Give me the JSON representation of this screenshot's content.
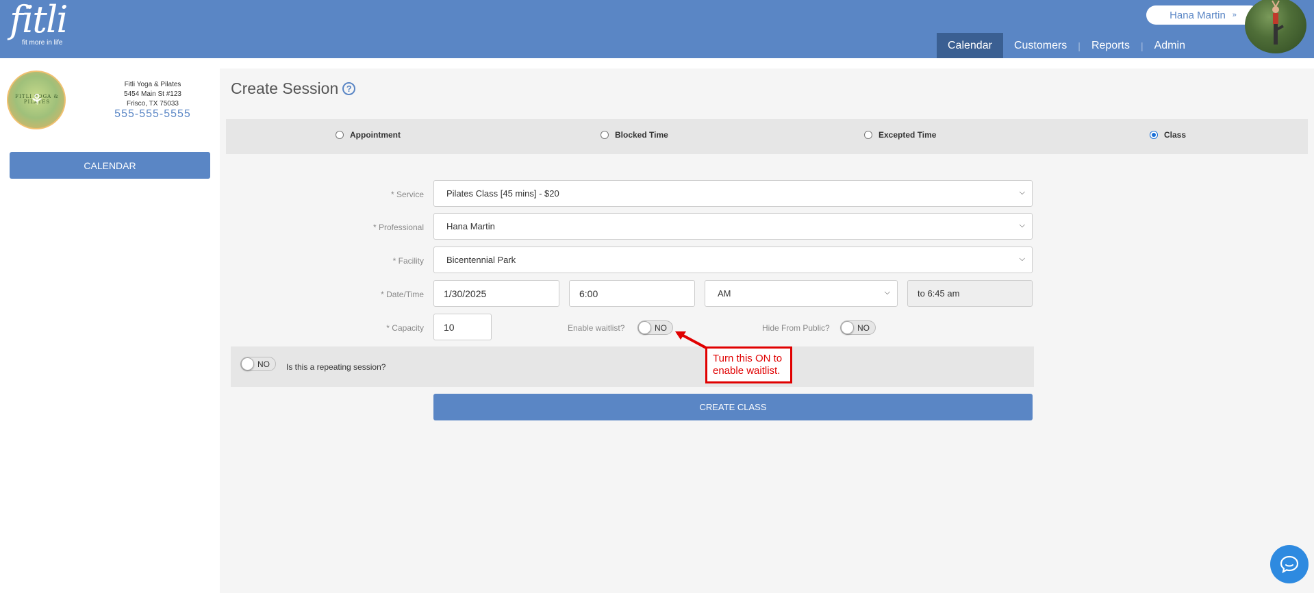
{
  "header": {
    "logo_text": "fitli",
    "logo_tagline": "fit more in life",
    "user_name": "Hana Martin",
    "nav": [
      {
        "label": "Calendar",
        "active": true
      },
      {
        "label": "Customers",
        "active": false
      },
      {
        "label": "Reports",
        "active": false
      },
      {
        "label": "Admin",
        "active": false
      }
    ]
  },
  "sidebar": {
    "studio_logo_text": "FITLI YOGA & PILATES",
    "studio_name": "Fitli Yoga & Pilates",
    "address_line1": "5454 Main St #123",
    "address_line2": "Frisco, TX 75033",
    "phone": "555-555-5555",
    "calendar_button": "CALENDAR"
  },
  "main": {
    "title": "Create Session",
    "help_icon": "?",
    "session_types": [
      {
        "label": "Appointment",
        "checked": false
      },
      {
        "label": "Blocked Time",
        "checked": false
      },
      {
        "label": "Excepted Time",
        "checked": false
      },
      {
        "label": "Class",
        "checked": true
      }
    ],
    "form": {
      "service_label": "* Service",
      "service_value": "Pilates Class [45 mins] - $20",
      "professional_label": "* Professional",
      "professional_value": "Hana Martin",
      "facility_label": "* Facility",
      "facility_value": "Bicentennial Park",
      "datetime_label": "* Date/Time",
      "date_value": "1/30/2025",
      "time_value": "6:00",
      "ampm_value": "AM",
      "end_time": "to 6:45 am",
      "capacity_label": "* Capacity",
      "capacity_value": "10",
      "waitlist_label": "Enable waitlist?",
      "waitlist_value": "NO",
      "hide_label": "Hide From Public?",
      "hide_value": "NO",
      "repeat_value": "NO",
      "repeat_label": "Is this a repeating session?"
    },
    "create_button": "CREATE CLASS",
    "callout_line1": "Turn this ON to",
    "callout_line2": "enable waitlist."
  },
  "colors": {
    "brand_blue": "#5a86c5",
    "nav_active": "#3a5f92",
    "callout_red": "#e00000",
    "chat_blue": "#2e8ae0"
  },
  "icons": {
    "help": "question-circle-icon",
    "dropdown": "chevron-down-icon",
    "chat": "chat-bubble-icon"
  }
}
